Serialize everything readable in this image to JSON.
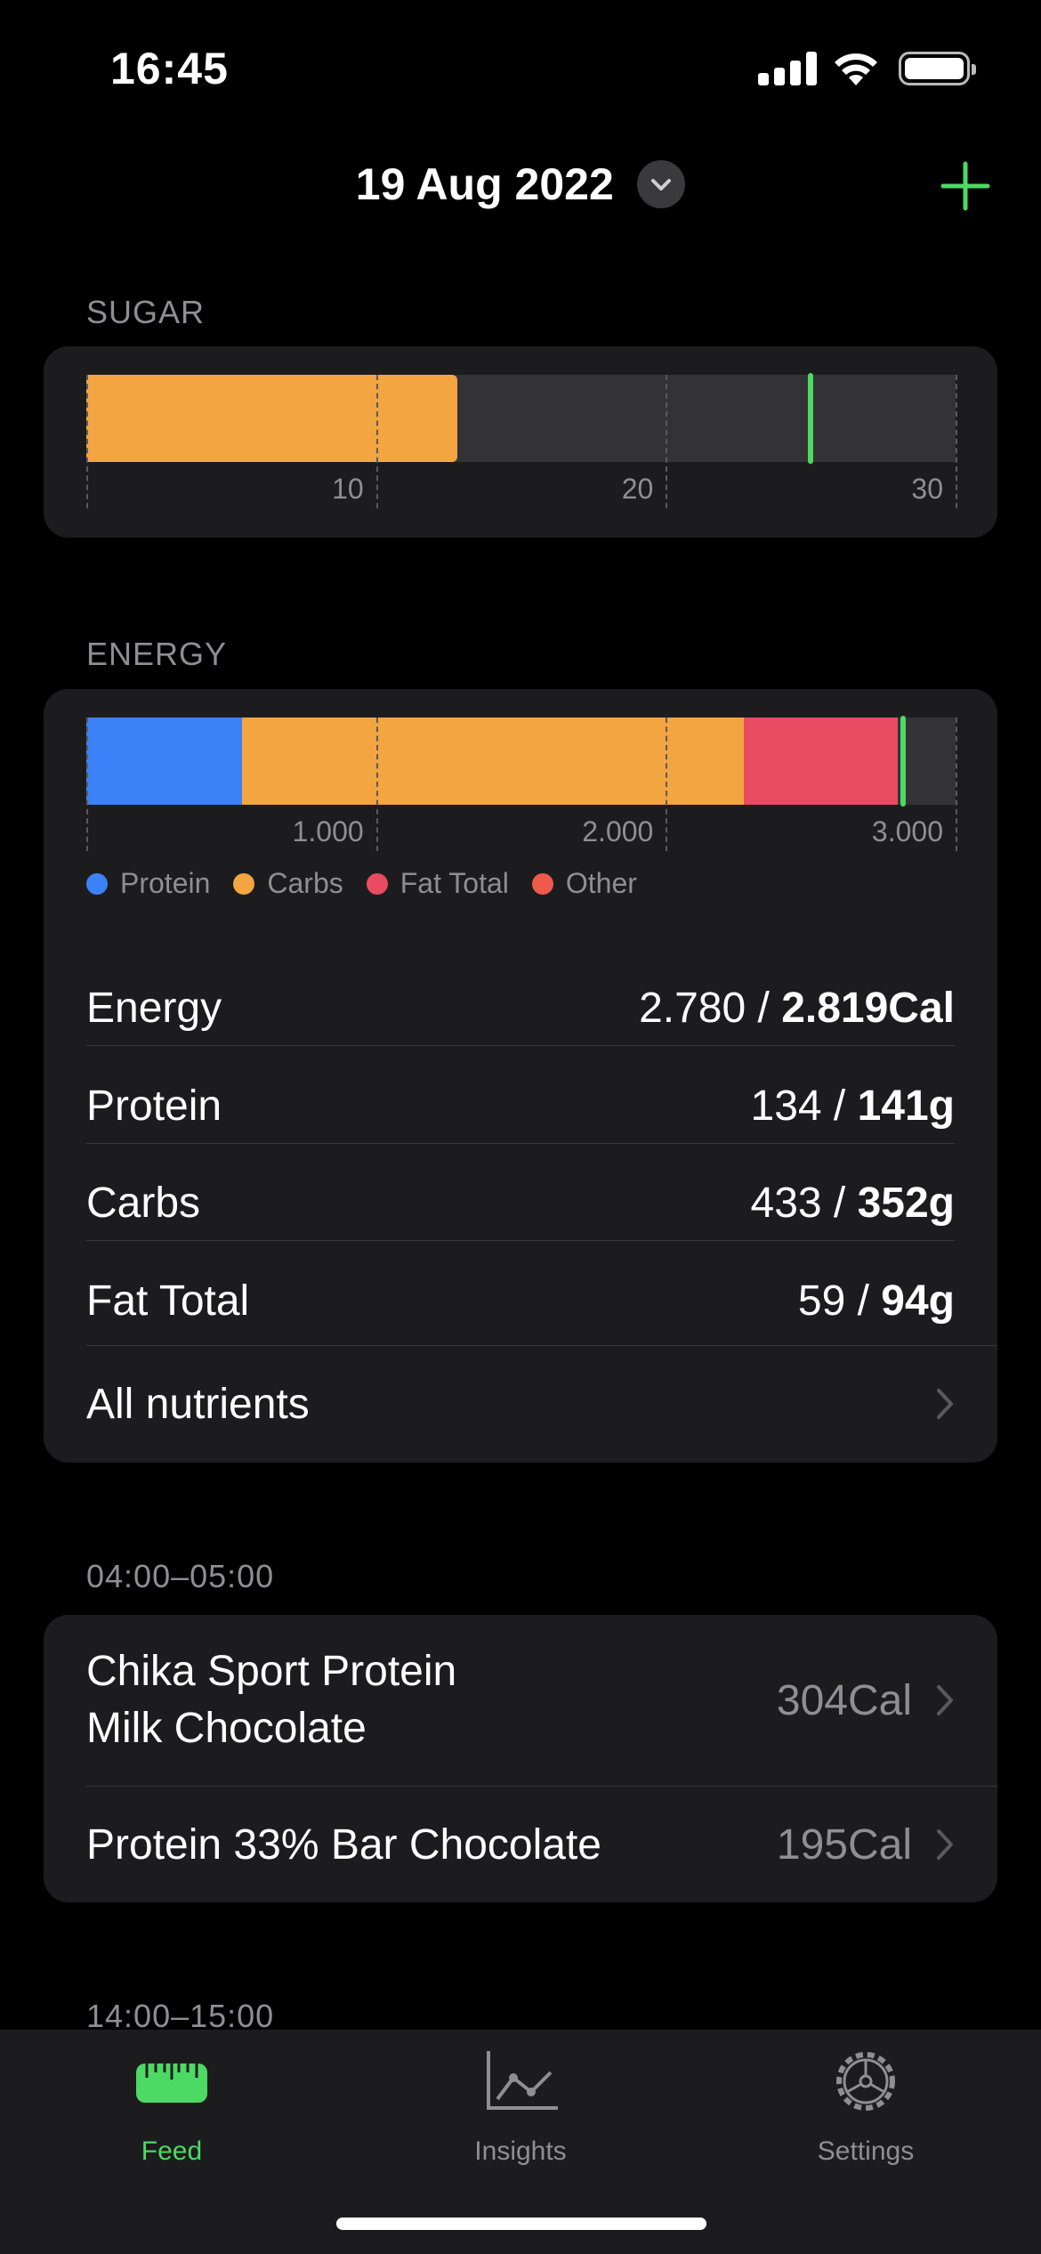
{
  "status_bar": {
    "time": "16:45"
  },
  "header": {
    "date": "19 Aug 2022"
  },
  "sugar": {
    "label": "SUGAR",
    "value": 12.8,
    "goal": 25,
    "max": 30,
    "ticks": [
      "10",
      "20",
      "30"
    ],
    "color": "#f2a541"
  },
  "energy": {
    "label": "ENERGY",
    "max": 3000,
    "goal": 2819,
    "ticks": [
      "1.000",
      "2.000",
      "3.000"
    ],
    "segments": [
      {
        "name": "Protein",
        "value": 536,
        "color": "#3b82f6"
      },
      {
        "name": "Carbs",
        "value": 1732,
        "color": "#f2a541"
      },
      {
        "name": "Fat Total",
        "value": 531,
        "color": "#e94b63"
      }
    ],
    "legend": [
      {
        "label": "Protein",
        "color": "#3b82f6"
      },
      {
        "label": "Carbs",
        "color": "#f2a541"
      },
      {
        "label": "Fat Total",
        "color": "#e94b63"
      },
      {
        "label": "Other",
        "color": "#ef5a4a"
      }
    ],
    "rows": [
      {
        "label": "Energy",
        "current": "2.780 / ",
        "target": "2.819Cal"
      },
      {
        "label": "Protein",
        "current": "134 / ",
        "target": "141g"
      },
      {
        "label": "Carbs",
        "current": "433 / ",
        "target": "352g"
      },
      {
        "label": "Fat Total",
        "current": "59 / ",
        "target": "94g"
      }
    ],
    "all_nutrients": "All nutrients"
  },
  "meals": {
    "time_label": "04:00–05:00",
    "items": [
      {
        "name_line1": "Chika Sport Protein",
        "name_line2": "Milk Chocolate",
        "calories": "304Cal"
      },
      {
        "name": "Protein 33% Bar Chocolate",
        "calories": "195Cal"
      }
    ],
    "next_time_label": "14:00–15:00"
  },
  "tabbar": {
    "tabs": [
      {
        "label": "Feed",
        "active": true
      },
      {
        "label": "Insights",
        "active": false
      },
      {
        "label": "Settings",
        "active": false
      }
    ]
  },
  "colors": {
    "accent": "#4cd964",
    "card": "#1c1c1e",
    "secondary_text": "#8e8e93"
  }
}
